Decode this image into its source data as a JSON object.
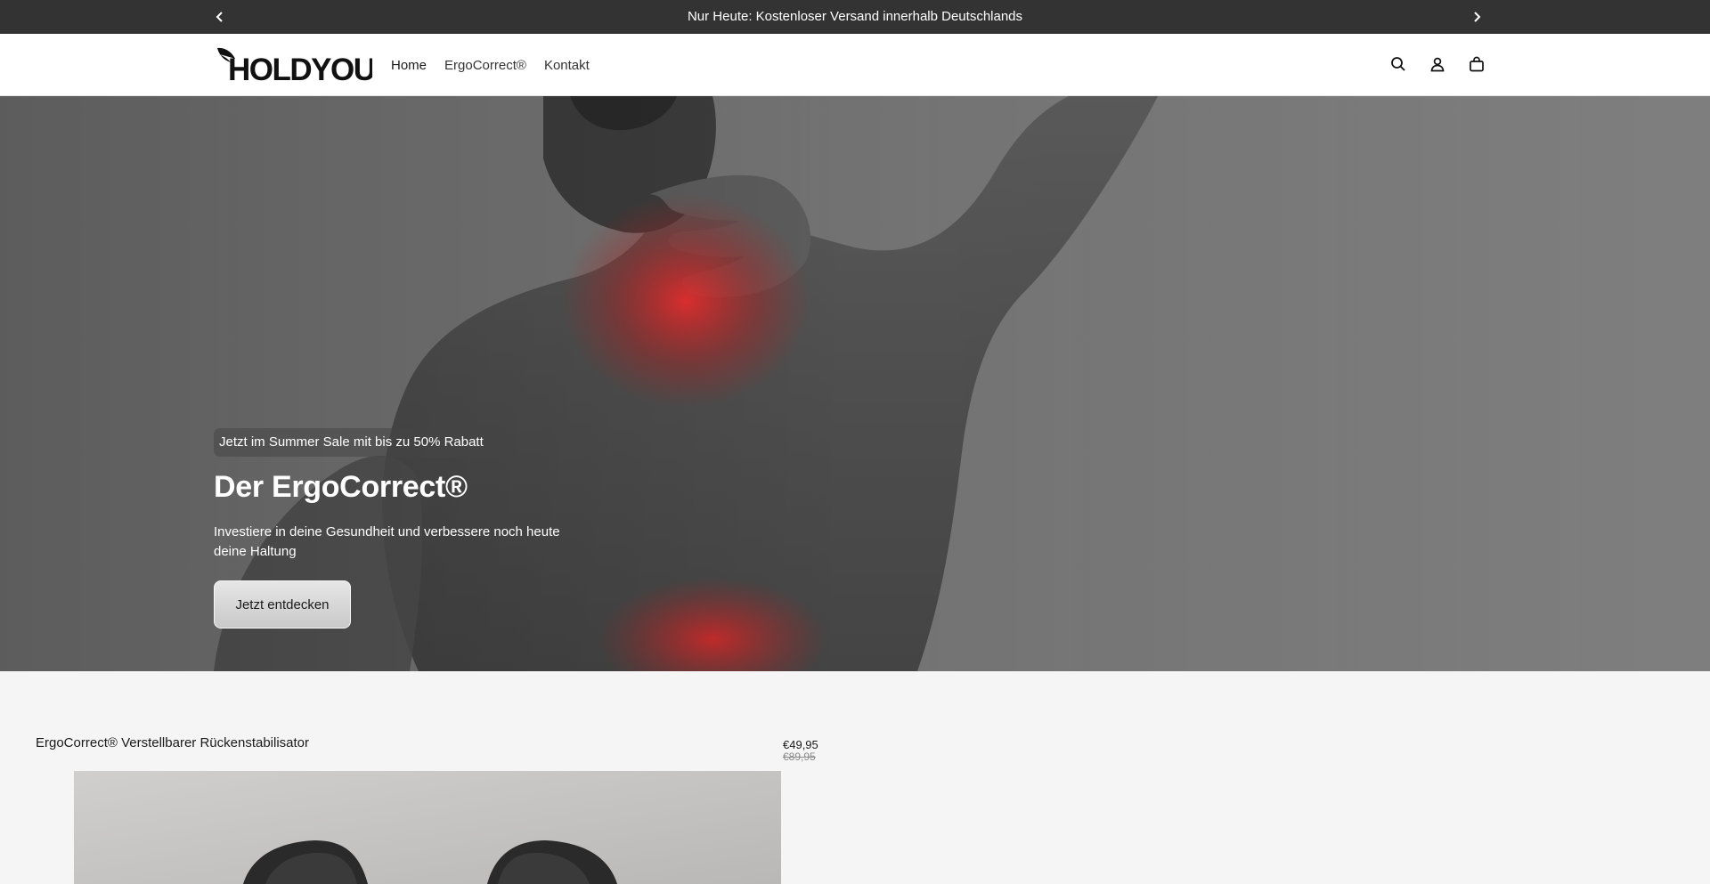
{
  "announcement": {
    "message": "Nur Heute: Kostenloser Versand innerhalb Deutschlands",
    "prev_icon": "chevron-left-icon",
    "next_icon": "chevron-right-icon"
  },
  "header": {
    "logo_text": "HOLDYOU",
    "nav": [
      {
        "label": "Home"
      },
      {
        "label": "ErgoCorrect®"
      },
      {
        "label": "Kontakt"
      }
    ],
    "icons": [
      "search-icon",
      "account-icon",
      "cart-icon"
    ]
  },
  "hero": {
    "badge": "Jetzt im Summer Sale mit bis zu 50% Rabatt",
    "title": "Der ErgoCorrect®",
    "subtitle": "Investiere in deine Gesundheit und verbessere noch heute deine Haltung",
    "cta_label": "Jetzt entdecken"
  },
  "product": {
    "title": "ErgoCorrect® Verstellbarer Rückenstabilisator",
    "price": "€49,95",
    "old_price": "€89,95"
  },
  "colors": {
    "announcement_bg": "#333333",
    "header_bg": "#ffffff",
    "page_bg": "#f5f5f5",
    "pain_highlight": "#e02020"
  }
}
